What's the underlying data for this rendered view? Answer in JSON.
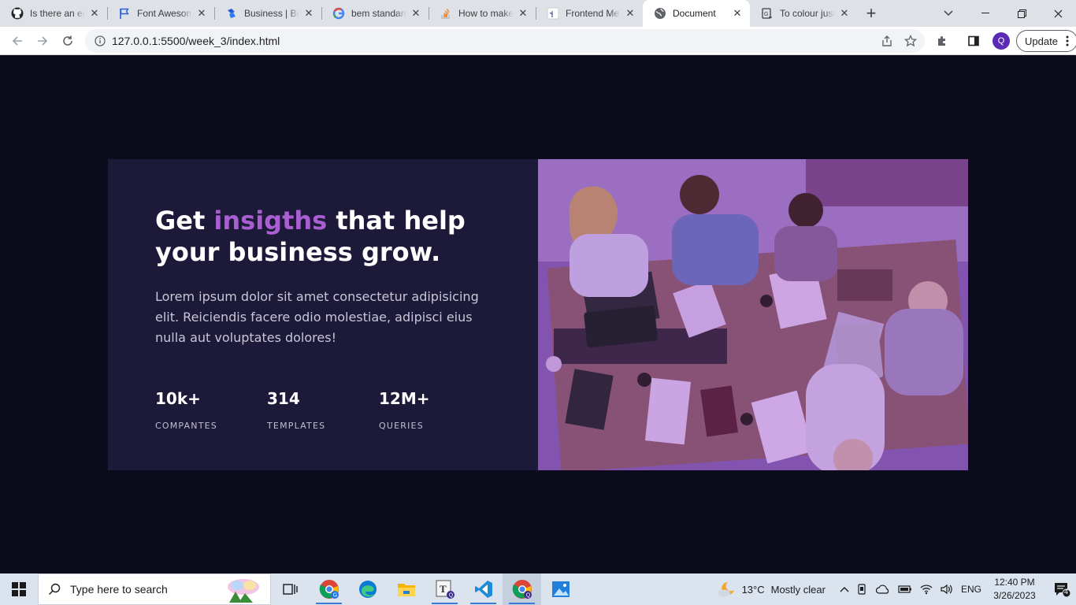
{
  "browser": {
    "tabs": [
      {
        "title": "Is there an eq",
        "icon": "github-icon"
      },
      {
        "title": "Font Awesome",
        "icon": "flag-icon"
      },
      {
        "title": "Business | Bo",
        "icon": "business-favicon-icon"
      },
      {
        "title": "bem standard",
        "icon": "google-icon"
      },
      {
        "title": "How to make",
        "icon": "stackoverflow-icon"
      },
      {
        "title": "Frontend Me",
        "icon": "frontend-mentor-icon"
      },
      {
        "title": "Document",
        "icon": "globe-icon",
        "active": true
      },
      {
        "title": "To colour just",
        "icon": "page-icon"
      }
    ],
    "url": "127.0.0.1:5500/week_3/index.html",
    "profile_initial": "Q",
    "update_label": "Update"
  },
  "hero": {
    "headline_pre": "Get",
    "headline_accent": "insigths",
    "headline_post": "that help your business grow.",
    "paragraph": "Lorem ipsum dolor sit amet consectetur adipisicing elit. Reiciendis facere odio molestiae, adipisci eius nulla aut voluptates dolores!",
    "stats": [
      {
        "value": "10k+",
        "label": "COMPANTES"
      },
      {
        "value": "314",
        "label": "TEMPLATES"
      },
      {
        "value": "12M+",
        "label": "QUERIES"
      }
    ],
    "accent_color": "#a95fd2",
    "card_color": "#1c1a38",
    "background_color": "#0b0b1c"
  },
  "taskbar": {
    "search_placeholder": "Type here to search",
    "weather_temp": "13°C",
    "weather_desc": "Mostly clear",
    "language": "ENG",
    "time": "12:40 PM",
    "date": "3/26/2023",
    "notification_count": "4"
  }
}
